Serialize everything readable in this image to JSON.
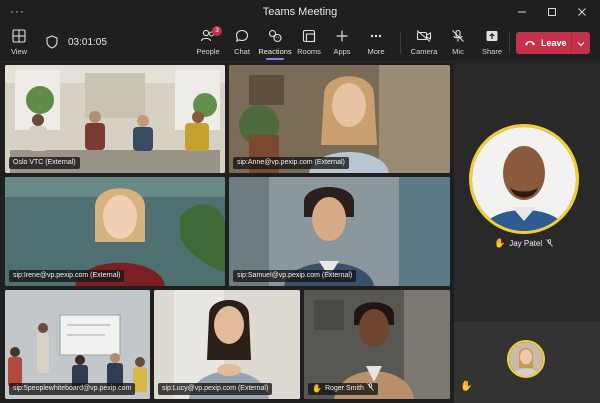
{
  "window": {
    "title": "Teams Meeting"
  },
  "toolbar": {
    "view_label": "View",
    "timer": "03:01:05",
    "people_label": "People",
    "people_badge": "3",
    "chat_label": "Chat",
    "reactions_label": "Reactions",
    "rooms_label": "Rooms",
    "apps_label": "Apps",
    "more_label": "More",
    "camera_label": "Camera",
    "mic_label": "Mic",
    "share_label": "Share",
    "leave_label": "Leave"
  },
  "tiles": [
    {
      "name": "Oslo VTC (External)"
    },
    {
      "name": "sip:Anne@vp.pexip.com (External)"
    },
    {
      "name": "sip:Irene@vp.pexip.com (External)"
    },
    {
      "name": "sip:Samuel@vp.pexip.com (External)"
    },
    {
      "name": "sip:5peoplewhiteboard@vp.pexip.com"
    },
    {
      "name": "sip:Lucy@vp.pexip.com (External)"
    },
    {
      "name": "Roger Smith"
    }
  ],
  "featured": {
    "name": "Jay Patel"
  },
  "colors": {
    "accent": "#7f85f5",
    "leave": "#c4314b",
    "highlight": "#f3cf2f"
  }
}
